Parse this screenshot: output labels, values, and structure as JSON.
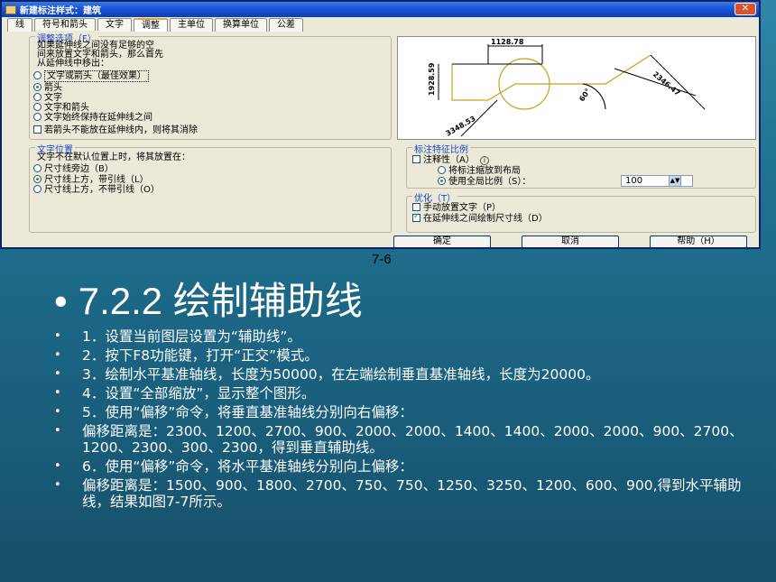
{
  "dialog": {
    "title": "新建标注样式：建筑",
    "close_label": "✕",
    "tabs": [
      "线",
      "符号和箭头",
      "文字",
      "调整",
      "主单位",
      "换算单位",
      "公差"
    ],
    "fit_options": {
      "title": "调整选项（F）",
      "description": [
        "如果延伸线之间没有足够的空",
        "间来放置文字和箭头，那么首先",
        "从延伸线中移出："
      ],
      "radios": [
        "文字或箭头（最佳效果）",
        "箭头",
        "文字",
        "文字和箭头",
        "文字始终保持在延伸线之间"
      ],
      "selected_index": 1,
      "suppress_check": "若箭头不能放在延伸线内，则将其消除"
    },
    "preview": {
      "dim_top": "1128.78",
      "dim_left": "1928.59",
      "dim_right": "2346.47",
      "dim_bottom": "3348.53",
      "angle": "60°"
    },
    "text_placement": {
      "title": "文字位置",
      "description": "文字不在默认位置上时，将其放置在：",
      "radios": [
        "尺寸线旁边（B）",
        "尺寸线上方，带引线（L）",
        "尺寸线上方，不带引线（O）"
      ],
      "selected_index": 1
    },
    "scale": {
      "title": "标注特征比例",
      "annotative": "注释性（A）",
      "info_icon_label": "i",
      "radio_layout": "将标注缩放到布局",
      "radio_global": "使用全局比例（S）：",
      "global_value": "100"
    },
    "fine_tuning": {
      "title": "优化（T）",
      "manual": "手动放置文字（P）",
      "draw_between": "在延伸线之间绘制尺寸线（D）"
    },
    "buttons": {
      "ok": "确定",
      "cancel": "取消",
      "help": "帮助（H）"
    }
  },
  "caption": "7-6",
  "heading": "7.2.2 绘制辅助线",
  "heading_bullet": "•",
  "bullet_symbol": "•",
  "bullets": [
    "1．设置当前图层设置为“辅助线”。",
    "2．按下F8功能键，打开“正交”模式。",
    "3．绘制水平基准轴线，长度为50000，在左端绘制垂直基准轴线，长度为20000。",
    "4．设置“全部缩放”，显示整个图形。",
    "5．使用“偏移”命令，将垂直基准轴线分别向右偏移：",
    "偏移距离是：2300、1200、2700、900、2000、2000、1400、1400、2000、2000、900、2700、1200、2300、300、2300，得到垂直辅助线。",
    "6．使用“偏移”命令，将水平基准轴线分别向上偏移：",
    "偏移距离是：1500、900、1800、2700、750、750、1250、3250、1200、600、900,得到水平辅助线，结果如图7-7所示。"
  ]
}
